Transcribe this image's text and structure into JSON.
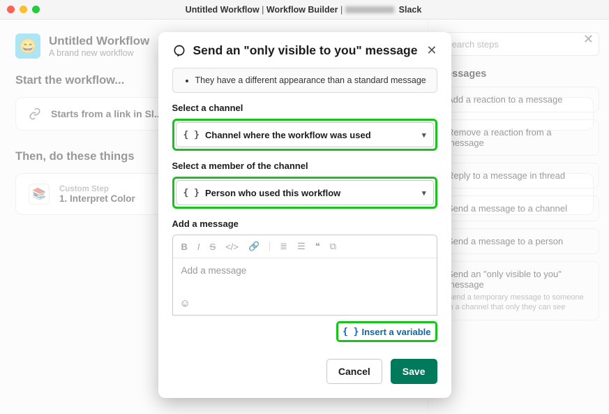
{
  "window": {
    "title_prefix": "Untitled Workflow",
    "title_mid": "Workflow Builder",
    "title_suffix": "Slack"
  },
  "workflow": {
    "name": "Untitled Workflow",
    "subtitle": "A brand new workflow",
    "start_heading": "Start the workflow...",
    "trigger_label": "Starts from a link in Sl...",
    "then_heading": "Then, do these things",
    "step_badge": "Custom Step",
    "step_name": "1. Interpret Color"
  },
  "sidebar": {
    "search_placeholder": "Search steps",
    "category": "Messages",
    "options": [
      {
        "title": "Add a reaction to a message"
      },
      {
        "title": "Remove a reaction from a message"
      },
      {
        "title": "Reply to a message in thread"
      },
      {
        "title": "Send a message to a channel"
      },
      {
        "title": "Send a message to a person"
      },
      {
        "title": "Send an \"only visible to you\" message",
        "desc": "Send a temporary message to someone in a channel that only they can see"
      }
    ]
  },
  "modal": {
    "title": "Send an \"only visible to you\" message",
    "info_bullet": "They have a different appearance than a standard message",
    "channel_label": "Select a channel",
    "channel_value": "Channel where the workflow was used",
    "member_label": "Select a member of the channel",
    "member_value": "Person who used this workflow",
    "message_label": "Add a message",
    "message_placeholder": "Add a message",
    "insert_variable": "Insert a variable",
    "cancel": "Cancel",
    "save": "Save"
  }
}
